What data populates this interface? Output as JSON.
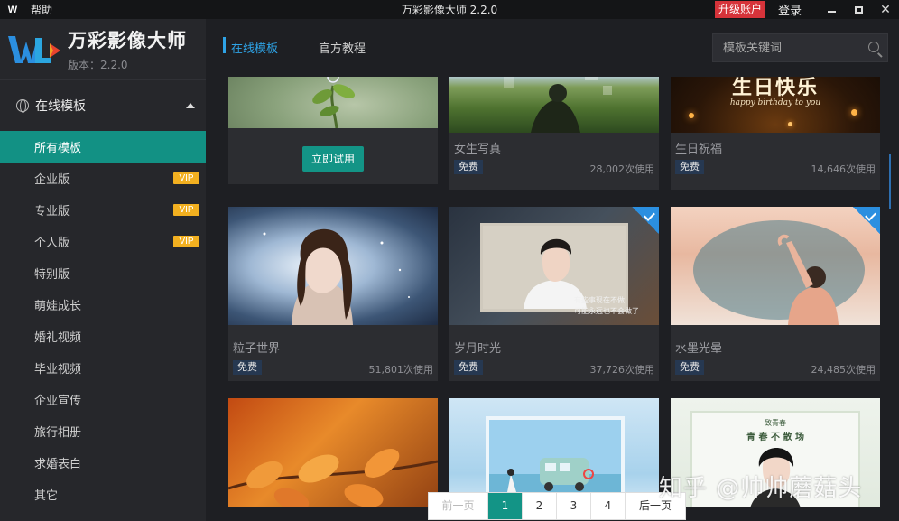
{
  "titlebar": {
    "logo_text": "W",
    "help_label": "帮助",
    "title": "万彩影像大师 2.2.0",
    "upgrade_label": "升级账户",
    "login_label": "登录"
  },
  "brand": {
    "name": "万彩影像大师",
    "version": "版本：2.2.0"
  },
  "sidebar": {
    "section_label": "在线模板",
    "items": [
      {
        "label": "所有模板",
        "vip": ""
      },
      {
        "label": "企业版",
        "vip": "VIP"
      },
      {
        "label": "专业版",
        "vip": "VIP"
      },
      {
        "label": "个人版",
        "vip": "VIP"
      },
      {
        "label": "特别版",
        "vip": ""
      },
      {
        "label": "萌娃成长",
        "vip": ""
      },
      {
        "label": "婚礼视频",
        "vip": ""
      },
      {
        "label": "毕业视频",
        "vip": ""
      },
      {
        "label": "企业宣传",
        "vip": ""
      },
      {
        "label": "旅行相册",
        "vip": ""
      },
      {
        "label": "求婚表白",
        "vip": ""
      },
      {
        "label": "其它",
        "vip": ""
      }
    ]
  },
  "tabs": {
    "online": "在线模板",
    "tutorial": "官方教程"
  },
  "search": {
    "placeholder": "模板关键词"
  },
  "cards": [
    {
      "title": "",
      "button": "立即试用"
    },
    {
      "title": "女生写真",
      "badge": "免费",
      "uses": "28,002次使用"
    },
    {
      "title": "生日祝福",
      "badge": "免费",
      "uses": "14,646次使用",
      "thumb_text1": "生日快乐",
      "thumb_text2": "happy birthday to you"
    },
    {
      "title": "粒子世界",
      "badge": "免费",
      "uses": "51,801次使用"
    },
    {
      "title": "岁月时光",
      "badge": "免费",
      "uses": "37,726次使用",
      "thumb_text1": "有些事现在不做",
      "thumb_text2": "可能永远也不会做了"
    },
    {
      "title": "水墨光晕",
      "badge": "免费",
      "uses": "24,485次使用"
    },
    {
      "title": ""
    },
    {
      "title": ""
    },
    {
      "title": "",
      "thumb_text1": "致青春",
      "thumb_text2": "青 春 不 散 场"
    }
  ],
  "pagination": {
    "prev": "前一页",
    "pages": [
      "1",
      "2",
      "3",
      "4"
    ],
    "next": "后一页",
    "current": 1
  },
  "watermark": "知乎 @帅帅蘑菇头",
  "colors": {
    "accent_teal": "#139486",
    "accent_blue": "#2ea3e6",
    "vip_yellow": "#f2b020",
    "upgrade_red": "#d6333a"
  }
}
